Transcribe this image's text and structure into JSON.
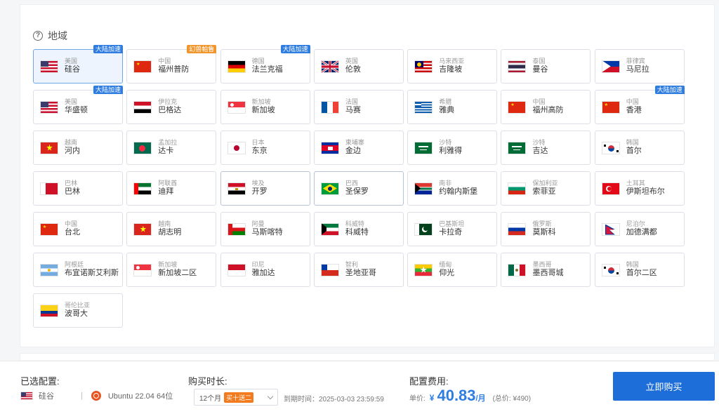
{
  "section": {
    "title": "地域"
  },
  "regions": [
    {
      "country": "美国",
      "city": "硅谷",
      "tag": "大陆加速",
      "tag_color": "blue",
      "selected": true,
      "flag": "us"
    },
    {
      "country": "中国",
      "city": "福州普防",
      "tag": "幻兽帕鲁",
      "tag_color": "orange",
      "flag": "cn"
    },
    {
      "country": "德国",
      "city": "法兰克福",
      "tag": "大陆加速",
      "tag_color": "blue",
      "flag": "de"
    },
    {
      "country": "英国",
      "city": "伦敦",
      "flag": "gb"
    },
    {
      "country": "马来西亚",
      "city": "吉隆坡",
      "flag": "my"
    },
    {
      "country": "泰国",
      "city": "曼谷",
      "flag": "th"
    },
    {
      "country": "菲律宾",
      "city": "马尼拉",
      "flag": "ph"
    },
    {
      "country": "美国",
      "city": "华盛顿",
      "tag": "大陆加速",
      "tag_color": "blue",
      "flag": "us"
    },
    {
      "country": "伊拉克",
      "city": "巴格达",
      "flag": "iq"
    },
    {
      "country": "新加坡",
      "city": "新加坡",
      "flag": "sg"
    },
    {
      "country": "法国",
      "city": "马赛",
      "flag": "fr"
    },
    {
      "country": "希腊",
      "city": "雅典",
      "flag": "gr"
    },
    {
      "country": "中国",
      "city": "福州高防",
      "flag": "cn"
    },
    {
      "country": "中国",
      "city": "香港",
      "tag": "大陆加速",
      "tag_color": "blue",
      "flag": "cn"
    },
    {
      "country": "越南",
      "city": "河内",
      "flag": "vn"
    },
    {
      "country": "孟加拉",
      "city": "达卡",
      "flag": "bd"
    },
    {
      "country": "日本",
      "city": "东京",
      "flag": "jp"
    },
    {
      "country": "柬埔寨",
      "city": "金边",
      "flag": "kh"
    },
    {
      "country": "沙特",
      "city": "利雅得",
      "flag": "sa"
    },
    {
      "country": "沙特",
      "city": "吉达",
      "flag": "sa"
    },
    {
      "country": "韩国",
      "city": "首尔",
      "flag": "kr"
    },
    {
      "country": "巴林",
      "city": "巴林",
      "flag": "bh"
    },
    {
      "country": "阿联酋",
      "city": "迪拜",
      "flag": "ae"
    },
    {
      "country": "埃及",
      "city": "开罗",
      "flag": "eg",
      "hover": true
    },
    {
      "country": "巴西",
      "city": "圣保罗",
      "flag": "br",
      "hover": true
    },
    {
      "country": "南非",
      "city": "约翰内斯堡",
      "flag": "za"
    },
    {
      "country": "保加利亚",
      "city": "索菲亚",
      "flag": "bg"
    },
    {
      "country": "土耳其",
      "city": "伊斯坦布尔",
      "flag": "tr"
    },
    {
      "country": "中国",
      "city": "台北",
      "flag": "cn"
    },
    {
      "country": "越南",
      "city": "胡志明",
      "flag": "vn"
    },
    {
      "country": "阿曼",
      "city": "马斯喀特",
      "flag": "om"
    },
    {
      "country": "科威特",
      "city": "科威特",
      "flag": "kw"
    },
    {
      "country": "巴基斯坦",
      "city": "卡拉奇",
      "flag": "pk"
    },
    {
      "country": "俄罗斯",
      "city": "莫斯科",
      "flag": "ru"
    },
    {
      "country": "尼泊尔",
      "city": "加德满都",
      "flag": "np"
    },
    {
      "country": "阿根廷",
      "city": "布宜诺斯艾利斯",
      "flag": "ar"
    },
    {
      "country": "新加坡",
      "city": "新加坡二区",
      "flag": "sg"
    },
    {
      "country": "印尼",
      "city": "雅加达",
      "flag": "id"
    },
    {
      "country": "智利",
      "city": "圣地亚哥",
      "flag": "cl"
    },
    {
      "country": "缅甸",
      "city": "仰光",
      "flag": "mm"
    },
    {
      "country": "墨西哥",
      "city": "墨西哥城",
      "flag": "mx"
    },
    {
      "country": "韩国",
      "city": "首尔二区",
      "flag": "kr"
    },
    {
      "country": "哥伦比亚",
      "city": "波哥大",
      "flag": "co"
    }
  ],
  "footer": {
    "selected_label": "已选配置:",
    "selected_region": "硅谷",
    "separator": "|",
    "selected_os": "Ubuntu 22.04 64位",
    "duration_label": "购买时长:",
    "duration_value": "12个月",
    "duration_promo": "买十送二",
    "expire_text": "到期时间：2025-03-03 23:59:59",
    "cost_label": "配置费用:",
    "unit_price_label": "单价:",
    "currency": "¥",
    "price": "40.83",
    "price_unit": "/月",
    "total": "(总价: ¥490)",
    "buy_label": "立即购买"
  },
  "colors": {
    "accent": "#1d6ed8",
    "tag_blue": "#2f7de1",
    "tag_orange": "#f0962c",
    "promo": "#f27b1f"
  }
}
